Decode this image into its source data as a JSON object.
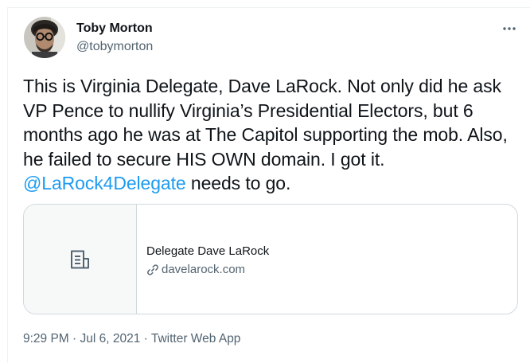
{
  "author": {
    "name": "Toby Morton",
    "handle": "@tobymorton",
    "avatar_icon": "profile-photo"
  },
  "more_icon": "more-icon",
  "tweet": {
    "text_before": "This is Virginia Delegate, Dave LaRock. Not only did he ask VP Pence to nullify Virginia’s Presidential Electors, but 6 months ago he was at The Capitol supporting the mob. Also, he failed to secure HIS OWN domain. I got it. ",
    "mention": "@LaRock4Delegate",
    "text_after": " needs to go."
  },
  "card": {
    "thumb_icon": "document-icon",
    "title": "Delegate Dave LaRock",
    "link_icon": "link-icon",
    "domain": "davelarock.com"
  },
  "meta": {
    "time": "9:29 PM",
    "sep1": " · ",
    "date": "Jul 6, 2021",
    "sep2": " · ",
    "app": "Twitter Web App"
  },
  "colors": {
    "accent": "#1d9bf0",
    "text": "#0f1419",
    "secondary": "#536471",
    "border": "#cfd9de"
  }
}
